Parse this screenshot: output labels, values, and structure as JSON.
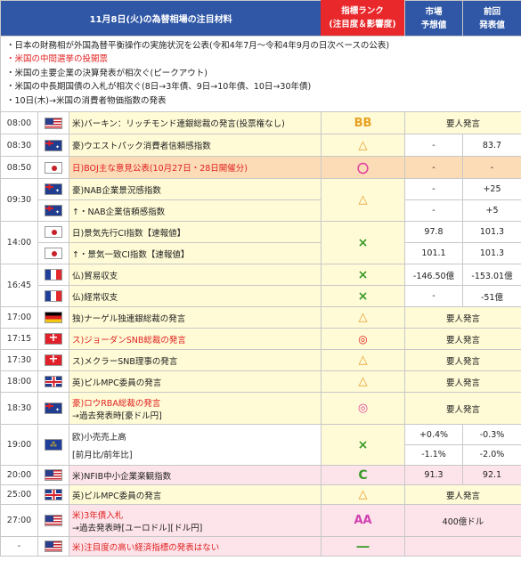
{
  "header": {
    "title": "11月8日(火)の為替相場の注目材料",
    "rank_line1": "指標ランク",
    "rank_line2": "(注目度＆影響度)",
    "market_line1": "市場",
    "market_line2": "予想値",
    "prev_line1": "前回",
    "prev_line2": "発表値"
  },
  "notes": [
    {
      "text": "・日本の財務相が外国為替平衡操作の実施状況を公表(令和4年7月～令和4年9月の日次ベースの公表)",
      "red": false
    },
    {
      "text": "・米国の中間選挙の投開票",
      "red": true
    },
    {
      "text": "・米国の主要企業の決算発表が相次ぐ(ピークアウト)",
      "red": false
    },
    {
      "text": "・米国の中長期国債の入札が相次ぐ(8日→3年債、9日→10年債、10日→30年債)",
      "red": false
    },
    {
      "text": "・10日(木)→米国の消費者物価指数の発表",
      "red": false
    }
  ],
  "rows": [
    {
      "time": "08:00",
      "flag": "us",
      "event": "米)バーキン：リッチモンド連銀総裁の発言(投票権なし)",
      "rank": "BB"
    },
    {
      "time": "08:30",
      "flag": "au",
      "event": "豪)ウエストパック消費者信頼感指数",
      "rank": "△",
      "forecast": "-",
      "previous": "83.7"
    },
    {
      "time": "08:50",
      "flag": "jp",
      "event": "日)BOJ主な意見公表(10月27日・28日開催分)",
      "rank": "〇",
      "forecast": "-",
      "previous": "-"
    },
    {
      "time": "09:30",
      "flag": "au",
      "event": "豪)NAB企業景況感指数",
      "forecast": "-",
      "previous": "+25",
      "rank": "△"
    },
    {
      "flag": "au",
      "event": "↑・NAB企業信頼感指数",
      "forecast": "-",
      "previous": "+5"
    },
    {
      "time": "14:00",
      "flag": "jp",
      "event": "日)景気先行CI指数【速報値】",
      "forecast": "97.8",
      "previous": "101.3",
      "rank": "×"
    },
    {
      "flag": "jp",
      "event": "↑・景気一致CI指数【速報値】",
      "forecast": "101.1",
      "previous": "101.3"
    },
    {
      "time": "16:45",
      "flag": "fr",
      "event": "仏)貿易収支",
      "rank": "×",
      "forecast": "-146.50億",
      "previous": "-153.01億"
    },
    {
      "flag": "fr",
      "event": "仏)経常収支",
      "rank": "×",
      "forecast": "-",
      "previous": "-51億"
    },
    {
      "time": "17:00",
      "flag": "de",
      "event": "独)ナーゲル独連銀総裁の発言",
      "rank": "△",
      "note": "要人発言"
    },
    {
      "time": "17:15",
      "flag": "ch",
      "event": "ス)ジョーダンSNB総裁の発言",
      "rank": "◎",
      "note": "要人発言"
    },
    {
      "time": "17:30",
      "flag": "ch",
      "event": "ス)メクラーSNB理事の発言",
      "rank": "△",
      "note": "要人発言"
    },
    {
      "time": "18:00",
      "flag": "uk",
      "event": "英)ピルMPC委員の発言",
      "rank": "△",
      "note": "要人発言"
    },
    {
      "time": "18:30",
      "flag": "au",
      "event": "豪)ロウRBA総裁の発言",
      "event2": "→過去発表時[豪ドル円]",
      "rank": "◎",
      "note": "要人発言"
    },
    {
      "time": "19:00",
      "flag": "eu",
      "event": "欧)小売売上高",
      "event2": "[前月比/前年比]",
      "rank": "×",
      "forecast": "+0.4%",
      "forecast2": "-1.1%",
      "previous": "-0.3%",
      "previous2": "-2.0%"
    },
    {
      "time": "20:00",
      "flag": "us",
      "event": "米)NFIB中小企業楽観指数",
      "rank": "C",
      "forecast": "91.3",
      "previous": "92.1"
    },
    {
      "time": "25:00",
      "flag": "uk",
      "event": "英)ピルMPC委員の発言",
      "rank": "△",
      "note": "要人発言"
    },
    {
      "time": "27:00",
      "flag": "us",
      "event": "米)3年債入札",
      "event2": "→過去発表時[ユーロドル][ドル円]",
      "rank": "AA",
      "note": "400億ドル"
    },
    {
      "time": "-",
      "flag": "us",
      "event": "米)注目度の高い経済指標の発表はない",
      "rank": "―"
    }
  ],
  "colors": {
    "header_blue": "#2f57a5",
    "header_red": "#e8282b",
    "row_yellow": "#fffbd6",
    "row_orange": "#fcdcb6",
    "row_pink": "#fde4ea"
  }
}
